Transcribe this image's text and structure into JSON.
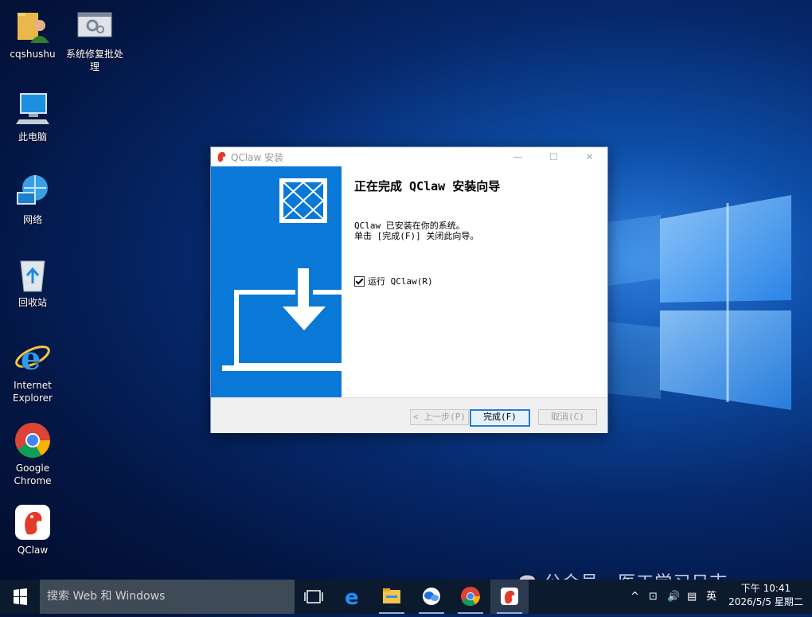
{
  "desktop": {
    "icons": [
      {
        "label": "cqshushu",
        "icon": "user-folder-icon"
      },
      {
        "label": "系统修复批处理",
        "icon": "batch-file-icon"
      },
      {
        "label": "此电脑",
        "icon": "computer-icon"
      },
      {
        "label": "网络",
        "icon": "network-icon"
      },
      {
        "label": "回收站",
        "icon": "recycle-bin-icon"
      },
      {
        "label": "Internet Explorer",
        "icon": "internet-explorer-icon"
      },
      {
        "label": "Google Chrome",
        "icon": "chrome-icon"
      },
      {
        "label": "QClaw",
        "icon": "qclaw-icon"
      }
    ]
  },
  "dialog": {
    "title": "QClaw 安装",
    "minimize": "—",
    "maximize": "☐",
    "close": "✕",
    "heading": "正在完成 QClaw 安装向导",
    "message_line1": "QClaw 已安装在你的系统。",
    "message_line2": "单击 [完成(F)] 关闭此向导。",
    "checkbox_label": "运行 QClaw(R)",
    "checkbox_checked": true,
    "buttons": {
      "back": "< 上一步(P)",
      "finish": "完成(F)",
      "cancel": "取消(C)"
    },
    "banner_color": "#0a78d7"
  },
  "taskbar": {
    "search_placeholder": "搜索 Web 和 Windows",
    "apps": [
      "task-view-icon",
      "edge-icon",
      "file-explorer-icon",
      "messaging-icon",
      "chrome-icon",
      "qclaw-icon"
    ],
    "tray_language": "英",
    "clock_time": "下午 10:41",
    "clock_date": "2026/5/5 星期二"
  },
  "watermark": "公众号 · 医工学习日志"
}
